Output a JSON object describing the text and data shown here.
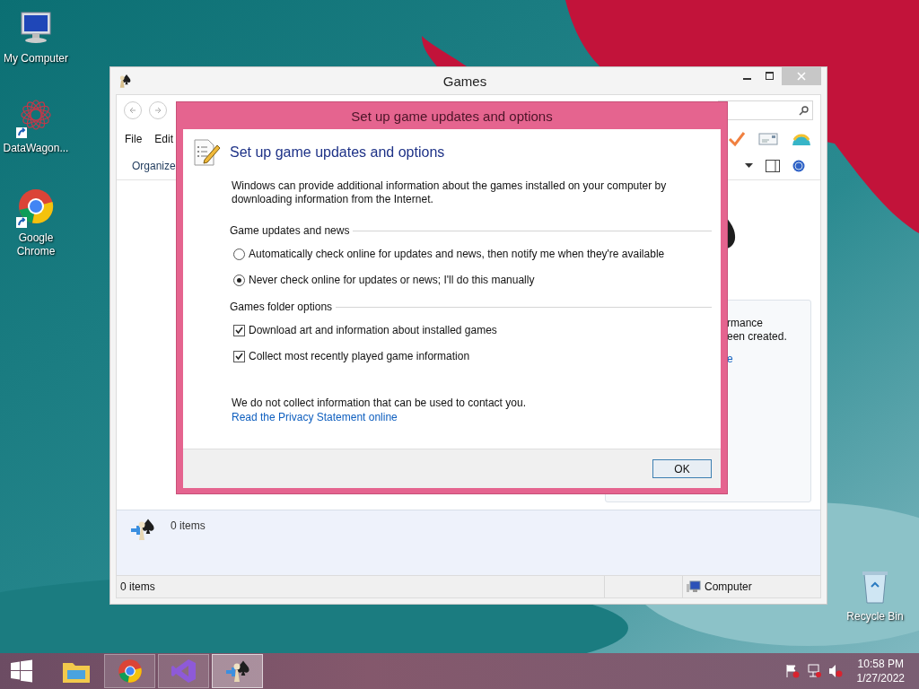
{
  "desktop_icons": [
    {
      "label": "My Computer",
      "kind": "computer",
      "shortcut": false
    },
    {
      "label": "DataWagon...",
      "kind": "network",
      "shortcut": true
    },
    {
      "label": "Google Chrome",
      "kind": "chrome",
      "shortcut": true
    },
    {
      "label": "Recycle Bin",
      "kind": "bin",
      "shortcut": false
    }
  ],
  "window": {
    "title": "Games",
    "menu": [
      "File",
      "Edit"
    ],
    "toolbar": {
      "organize": "Organize"
    },
    "info_panel": {
      "lines": [
        "rmance",
        "een created."
      ],
      "link": "e"
    },
    "details": {
      "text": "0 items"
    },
    "status_bar": {
      "left": "0 items",
      "right": "Computer"
    }
  },
  "dialog": {
    "title": "Set up game updates and options",
    "heading": "Set up game updates and options",
    "intro": "Windows can provide additional information about the games installed on your computer by downloading information from the Internet.",
    "sections": [
      {
        "title": "Game updates and news",
        "options": [
          {
            "kind": "radio",
            "label": "Automatically check online for updates and news, then notify me when they're available",
            "selected": false
          },
          {
            "kind": "radio",
            "label": "Never check online for updates or news; I'll do this manually",
            "selected": true
          }
        ]
      },
      {
        "title": "Games folder options",
        "options": [
          {
            "kind": "checkbox",
            "label": "Download art and information about installed games",
            "checked": true
          },
          {
            "kind": "checkbox",
            "label": "Collect most recently played game information",
            "checked": true
          }
        ]
      }
    ],
    "note": "We do not collect information that can be used to contact you.",
    "link": "Read the Privacy Statement online",
    "buttons": [
      "OK"
    ]
  },
  "taskbar": {
    "apps": [
      {
        "kind": "explorer",
        "running": false,
        "selected": false
      },
      {
        "kind": "chrome",
        "running": true,
        "selected": false
      },
      {
        "kind": "studio",
        "running": true,
        "selected": false
      },
      {
        "kind": "games",
        "running": true,
        "selected": true
      }
    ],
    "clock": {
      "time": "10:58 PM",
      "date": "1/27/2022"
    }
  }
}
